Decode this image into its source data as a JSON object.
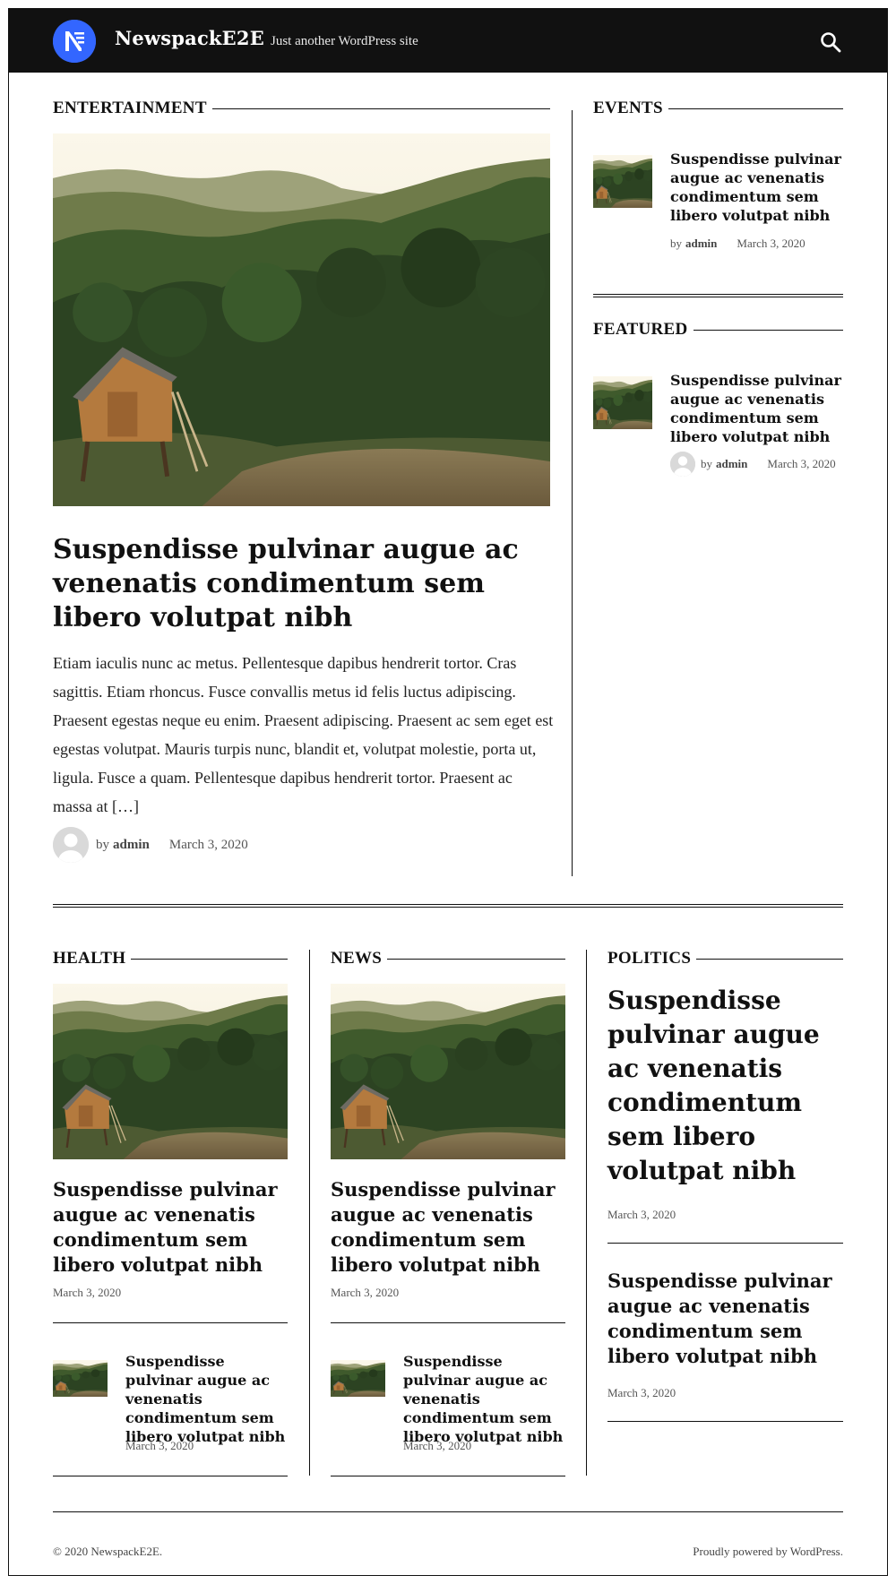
{
  "header": {
    "site_title": "NewspackE2E",
    "site_description": "Just another WordPress site",
    "icons": {
      "logo": "newspack-logo-icon",
      "search": "search-icon"
    },
    "colors": {
      "header_bg": "#111111",
      "logo_bg": "#3366ff"
    }
  },
  "entertainment": {
    "label": "ENTERTAINMENT",
    "title": "Suspendisse pulvinar augue ac venenatis condimentum sem libero volutpat nibh",
    "excerpt": "Etiam iaculis nunc ac metus. Pellentesque dapibus hendrerit tortor. Cras sagittis. Etiam rhoncus. Fusce convallis metus id felis luctus adipiscing. Praesent egestas neque eu enim. Praesent adipiscing. Praesent ac sem eget est egestas volutpat. Mauris turpis nunc, blandit et, volutpat molestie, porta ut, ligula. Fusce a quam. Pellentesque dapibus hendrerit tortor. Praesent ac massa at […]",
    "by": "by",
    "author": "admin",
    "date": "March 3, 2020"
  },
  "events": {
    "label": "EVENTS",
    "title": "Suspendisse pulvinar augue ac venenatis condimentum sem libero volutpat nibh",
    "by": "by",
    "author": "admin",
    "date": "March 3, 2020"
  },
  "featured": {
    "label": "FEATURED",
    "title": "Suspendisse pulvinar augue ac venenatis condimentum sem libero volutpat nibh",
    "by": "by",
    "author": "admin",
    "date": "March 3, 2020"
  },
  "health": {
    "label": "HEALTH",
    "main_title": "Suspendisse pulvinar augue ac venenatis condimentum sem libero volutpat nibh",
    "main_date": "March 3, 2020",
    "small_title": "Suspendisse pulvinar augue ac venenatis condimentum sem libero volutpat nibh",
    "small_date": "March 3, 2020"
  },
  "news": {
    "label": "NEWS",
    "main_title": "Suspendisse pulvinar augue ac venenatis condimentum sem libero volutpat nibh",
    "main_date": "March 3, 2020",
    "small_title": "Suspendisse pulvinar augue ac venenatis condimentum sem libero volutpat nibh",
    "small_date": "March 3, 2020"
  },
  "politics": {
    "label": "POLITICS",
    "main_title": "Suspendisse pulvinar augue ac venenatis condimentum sem libero volutpat nibh",
    "main_date": "March 3, 2020",
    "second_title": "Suspendisse pulvinar augue ac venenatis condimentum sem libero volutpat nibh",
    "second_date": "March 3, 2020"
  },
  "footer": {
    "copyright": "© 2020 NewspackE2E.",
    "powered": "Proudly powered by WordPress."
  }
}
